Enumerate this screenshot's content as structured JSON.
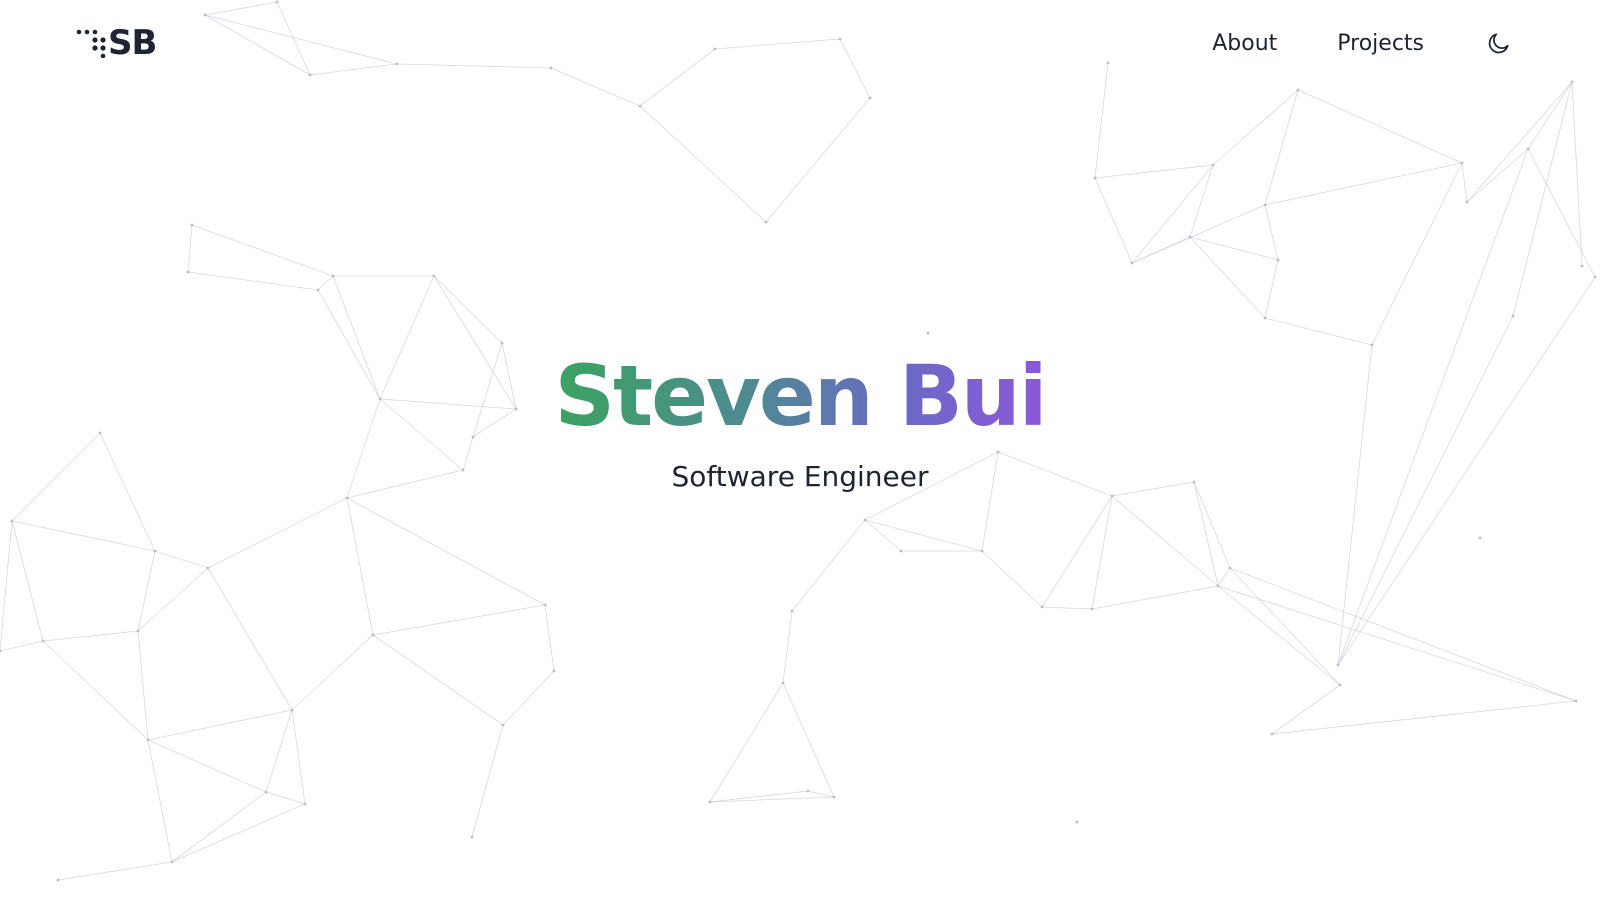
{
  "brand": {
    "logo_text": "SB",
    "icon": "dots-logo-icon"
  },
  "nav": {
    "items": [
      {
        "label": "About"
      },
      {
        "label": "Projects"
      }
    ],
    "theme_toggle_icon": "moon-icon"
  },
  "hero": {
    "name": "Steven Bui",
    "role": "Software Engineer"
  },
  "colors": {
    "text": "#1f2433",
    "gradient_start": "#3aa35f",
    "gradient_end": "#8e57dc",
    "network_lines": "#c9ccd6"
  }
}
